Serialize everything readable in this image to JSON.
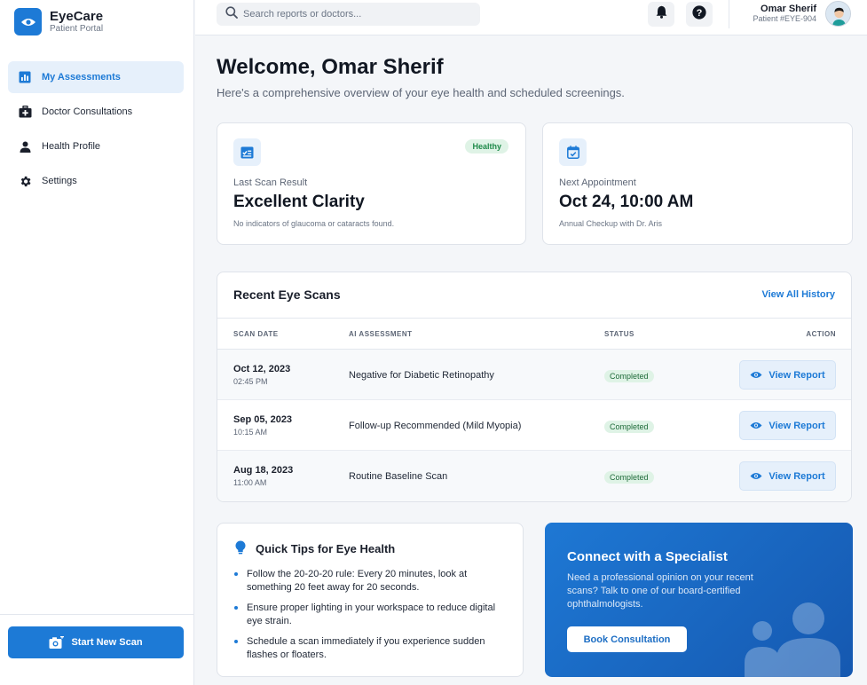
{
  "brand": {
    "name": "EyeCare",
    "subtitle": "Patient Portal"
  },
  "sidebar": {
    "items": [
      {
        "label": "My Assessments",
        "icon": "bar-chart-icon",
        "active": true
      },
      {
        "label": "Doctor Consultations",
        "icon": "medical-bag-icon",
        "active": false
      },
      {
        "label": "Health Profile",
        "icon": "person-icon",
        "active": false
      },
      {
        "label": "Settings",
        "icon": "gear-icon",
        "active": false
      }
    ],
    "start_scan_label": "Start New Scan"
  },
  "topbar": {
    "search_placeholder": "Search reports or doctors...",
    "user_name": "Omar Sherif",
    "user_id": "Patient #EYE-904"
  },
  "main": {
    "welcome": "Welcome, Omar Sherif",
    "subtitle": "Here's a comprehensive overview of your eye health and scheduled screenings."
  },
  "cards": {
    "scan": {
      "badge": "Healthy",
      "label": "Last Scan Result",
      "value": "Excellent Clarity",
      "note": "No indicators of glaucoma or cataracts found."
    },
    "appointment": {
      "label": "Next Appointment",
      "value": "Oct 24, 10:00 AM",
      "note": "Annual Checkup with Dr. Aris"
    }
  },
  "scans": {
    "title": "Recent Eye Scans",
    "view_all": "View All History",
    "columns": [
      "SCAN DATE",
      "AI ASSESSMENT",
      "STATUS",
      "ACTION"
    ],
    "rows": [
      {
        "date": "Oct 12, 2023",
        "time": "02:45 PM",
        "assessment": "Negative for Diabetic Retinopathy",
        "status": "Completed",
        "action": "View Report"
      },
      {
        "date": "Sep 05, 2023",
        "time": "10:15 AM",
        "assessment": "Follow-up Recommended (Mild Myopia)",
        "status": "Completed",
        "action": "View Report"
      },
      {
        "date": "Aug 18, 2023",
        "time": "11:00 AM",
        "assessment": "Routine Baseline Scan",
        "status": "Completed",
        "action": "View Report"
      }
    ]
  },
  "tips": {
    "title": "Quick Tips for Eye Health",
    "items": [
      "Follow the 20-20-20 rule: Every 20 minutes, look at something 20 feet away for 20 seconds.",
      "Ensure proper lighting in your workspace to reduce digital eye strain.",
      "Schedule a scan immediately if you experience sudden flashes or floaters."
    ]
  },
  "specialist": {
    "title": "Connect with a Specialist",
    "text": "Need a professional opinion on your recent scans? Talk to one of our board-certified ophthalmologists.",
    "button": "Book Consultation"
  },
  "colors": {
    "accent": "#1d7ad6",
    "success_bg": "#dff3e6",
    "success_text": "#1f8a4a"
  }
}
